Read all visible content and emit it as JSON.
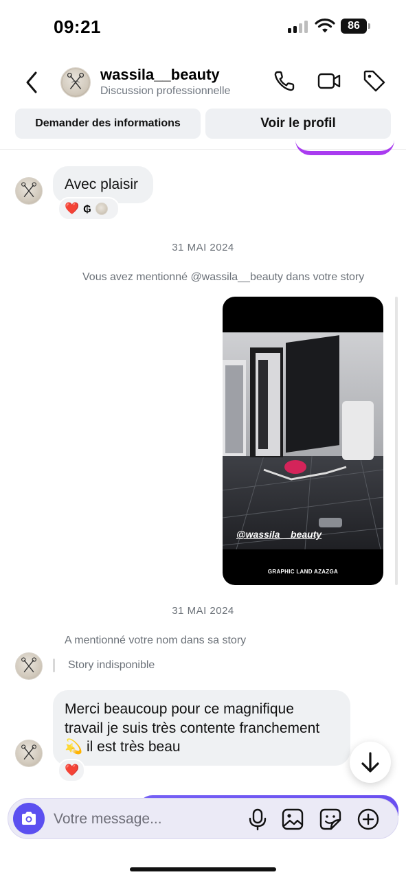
{
  "status_bar": {
    "time": "09:21",
    "battery": "86"
  },
  "header": {
    "username": "wassila__beauty",
    "subtitle": "Discussion professionnelle",
    "icons": [
      "chevron-left-icon",
      "phone-icon",
      "video-camera-icon",
      "tag-icon"
    ]
  },
  "actions": {
    "request_info": "Demander des informations",
    "view_profile": "Voir le profil"
  },
  "messages": [
    {
      "type": "incoming",
      "text": "Avec plaisir",
      "reactions": [
        "❤️",
        "₲"
      ]
    },
    {
      "type": "date",
      "text": "31 MAI 2024"
    },
    {
      "type": "system",
      "text": "Vous avez mentionné @wassila__beauty dans votre story"
    },
    {
      "type": "story",
      "handle": "@wassila__beauty",
      "caption": "GRAPHIC LAND AZAZGA"
    },
    {
      "type": "date",
      "text": "31 MAI 2024"
    },
    {
      "type": "system",
      "text": "A mentionné votre nom dans sa story"
    },
    {
      "type": "quote",
      "text": "Story indisponible"
    },
    {
      "type": "incoming",
      "text_line1": "Merci beaucoup pour ce magnifique",
      "text_line2": "travail je suis très contente franchement",
      "text_line3": "il est très beau",
      "emoji": "💫",
      "reactions": [
        "❤️"
      ]
    }
  ],
  "composer": {
    "placeholder": "Votre message...",
    "icons": [
      "camera-icon",
      "microphone-icon",
      "image-icon",
      "sticker-icon",
      "plus-circle-icon"
    ]
  },
  "colors": {
    "accent": "#5b4ff0",
    "outgoing_bubble": "#a93bf0",
    "incoming_bubble": "#eff1f3",
    "muted_text": "#6b7178"
  }
}
